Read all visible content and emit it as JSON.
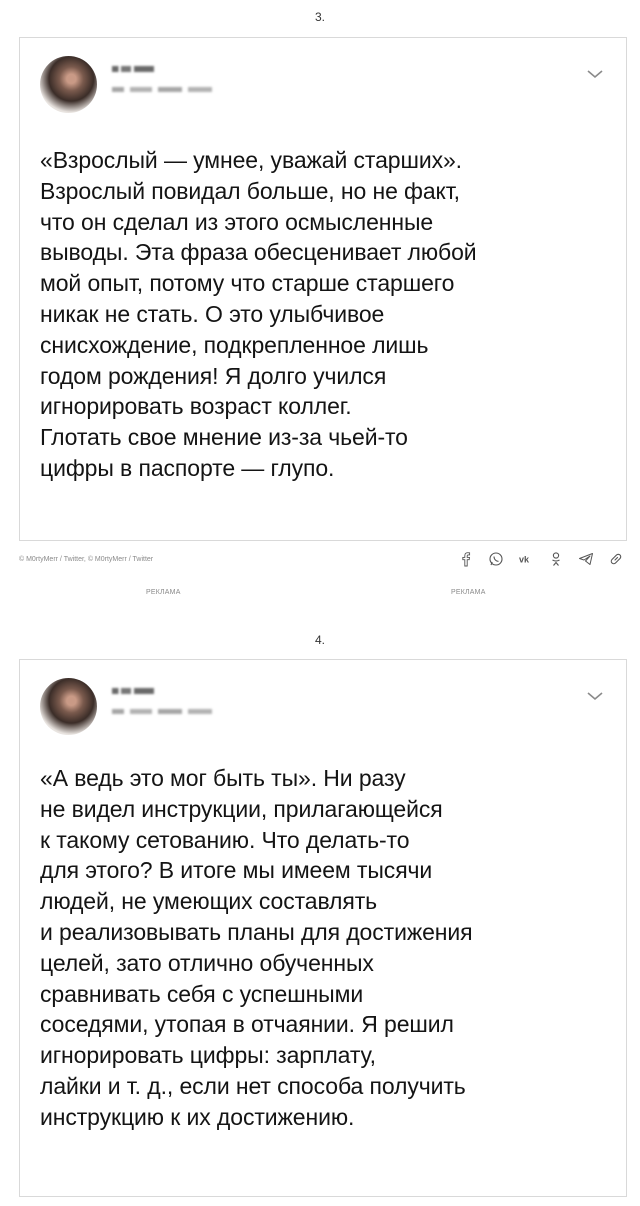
{
  "posts": [
    {
      "number": "3.",
      "text": "«Взрослый — умнее, уважай старших».\nВзрослый повидал больше, но не факт,\nчто он сделал из этого осмысленные\nвыводы. Эта фраза обесценивает любой\nмой опыт, потому что старше старшего\nникак не стать. О это улыбчивое\nснисхождение, подкрепленное лишь\nгодом рождения! Я долго учился\nигнорировать возраст коллег.\nГлотать свое мнение из-за чьей-то\nцифры в паспорте — глупо."
    },
    {
      "number": "4.",
      "text": "«А ведь это мог быть ты». Ни разу\nне видел инструкции, прилагающейся\nк такому сетованию. Что делать-то\nдля этого? В итоге мы имеем тысячи\nлюдей, не умеющих составлять\nи реализовывать планы для достижения\nцелей, зато отлично обученных\nсравнивать себя с успешными\nсоседями, утопая в отчаянии. Я решил\nигнорировать цифры: зарплату,\nлайки и т. д., если нет способа получить\nинструкцию к их достижению."
    }
  ],
  "credit": "© M0rtyMerr / Twitter, © M0rtyMerr / Twitter",
  "ads": [
    "РЕКЛАМА",
    "РЕКЛАМА"
  ],
  "share_icons": [
    "facebook-icon",
    "whatsapp-icon",
    "vk-icon",
    "odnoklassniki-icon",
    "telegram-icon",
    "link-icon"
  ],
  "colors": {
    "border": "#d9d9d9",
    "text": "#141414",
    "muted": "#8a8a8a"
  }
}
